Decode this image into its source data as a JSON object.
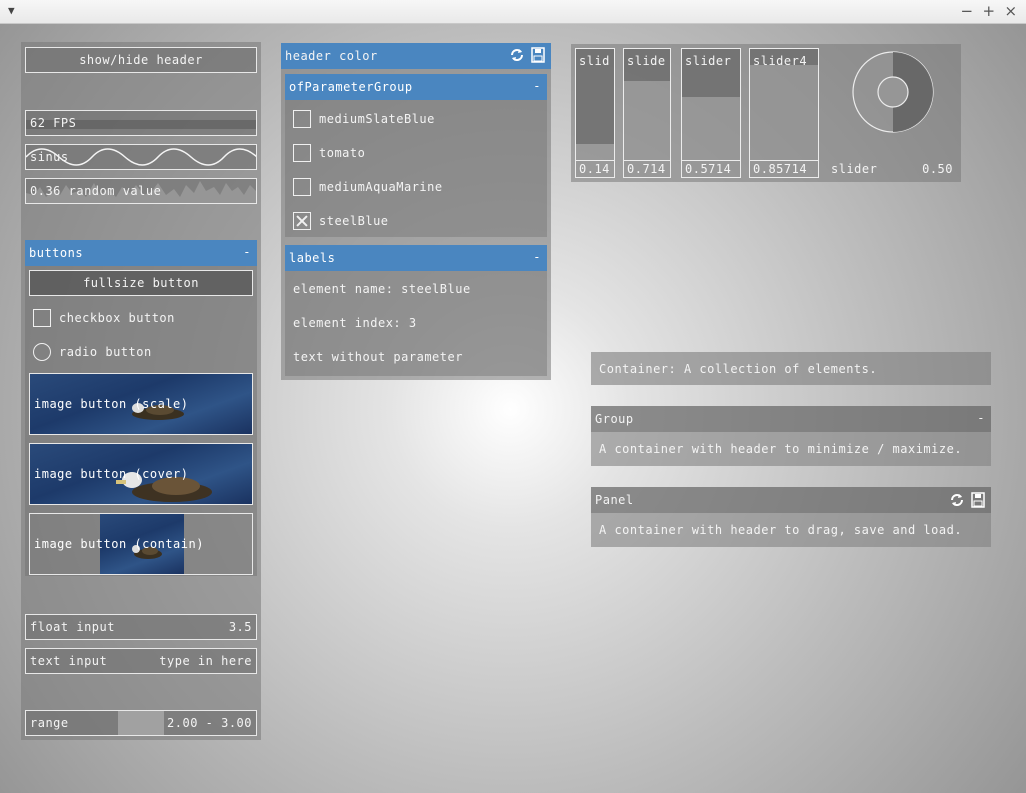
{
  "window": {
    "menu_icon": "dropdown-arrow-icon",
    "minimize": "−",
    "maximize": "+",
    "close": "×"
  },
  "left": {
    "show_hide_label": "show/hide header",
    "fps_label": "62 FPS",
    "sinus_label": "sinus",
    "random_label": "0.36 random value",
    "buttons_group": {
      "title": "buttons",
      "minimize": "-",
      "fullsize_label": "fullsize button",
      "checkbox_label": "checkbox button",
      "radio_label": "radio button",
      "image_scale_label": "image button (scale)",
      "image_cover_label": "image button (cover)",
      "image_contain_label": "image button (contain)"
    },
    "float_input": {
      "label": "float input",
      "value": "3.5"
    },
    "text_input": {
      "label": "text input",
      "value": "type in here"
    },
    "range": {
      "label": "range",
      "value": "2.00 - 3.00",
      "fill_from": 0.4,
      "fill_to": 0.6
    }
  },
  "header_color_panel": {
    "title": "header color",
    "group": {
      "title": "ofParameterGroup",
      "minimize": "-",
      "items": [
        {
          "label": "mediumSlateBlue",
          "checked": false
        },
        {
          "label": "tomato",
          "checked": false
        },
        {
          "label": "mediumAquaMarine",
          "checked": false
        },
        {
          "label": "steelBlue",
          "checked": true
        }
      ]
    },
    "labels": {
      "title": "labels",
      "minimize": "-",
      "element_name": "element name: steelBlue",
      "element_index": "element index: 3",
      "text_without": "text without parameter"
    }
  },
  "sliders": [
    {
      "name": "slid",
      "value": "0.14",
      "level": 0.14
    },
    {
      "name": "slide",
      "value": "0.714",
      "level": 0.714
    },
    {
      "name": "slider",
      "value": "0.5714",
      "level": 0.5714
    },
    {
      "name": "slider4",
      "value": "0.85714",
      "level": 0.85714
    }
  ],
  "rotary": {
    "label": "slider",
    "value": "0.50",
    "level": 0.5
  },
  "container_demo": {
    "container_text": "Container: A collection of elements.",
    "group_title": "Group",
    "group_minimize": "-",
    "group_text": "A container with header to minimize / maximize.",
    "panel_title": "Panel",
    "panel_text": "A container with header to drag, save and load."
  },
  "icons": {
    "reload": "reload-icon",
    "save": "save-icon"
  }
}
